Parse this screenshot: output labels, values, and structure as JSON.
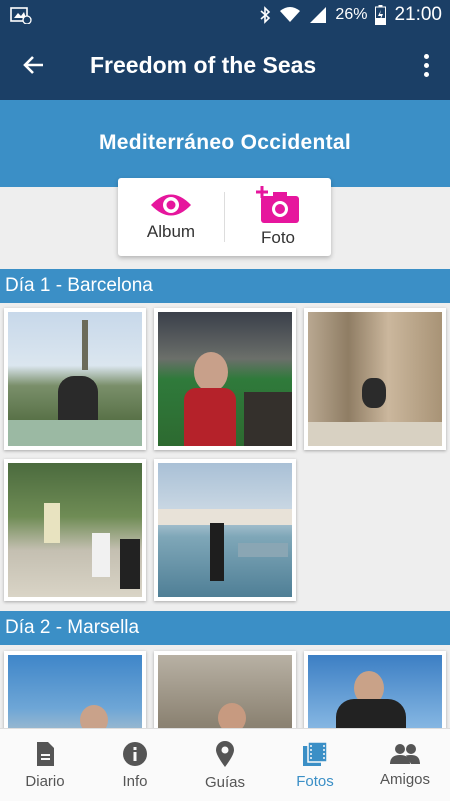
{
  "status": {
    "battery": "26%",
    "time": "21:00"
  },
  "appbar": {
    "title": "Freedom of the Seas"
  },
  "hero": {
    "cruise_name": "Mediterráneo Occidental"
  },
  "actions": {
    "album_label": "Album",
    "photo_label": "Foto"
  },
  "sections": [
    {
      "label": "Día 1 - Barcelona"
    },
    {
      "label": "Día 2 - Marsella"
    }
  ],
  "bottom_nav": [
    {
      "label": "Diario",
      "icon": "diary-icon"
    },
    {
      "label": "Info",
      "icon": "info-icon"
    },
    {
      "label": "Guías",
      "icon": "location-pin-icon"
    },
    {
      "label": "Fotos",
      "icon": "photos-icon",
      "active": true
    },
    {
      "label": "Amigos",
      "icon": "people-icon"
    }
  ],
  "colors": {
    "appbar": "#1b3f66",
    "accent": "#3b8fc6",
    "magenta": "#e6169d"
  }
}
